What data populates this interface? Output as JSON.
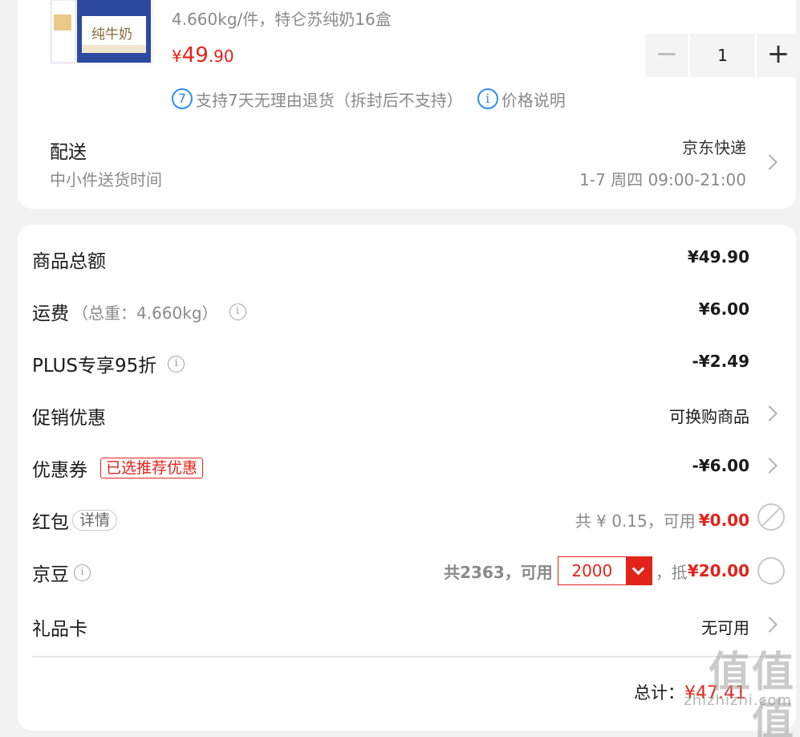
{
  "product": {
    "spec": "4.660kg/件，特仑苏纯奶16盒",
    "image_text": "纯牛奶",
    "price_yen": "¥",
    "price_int": "49",
    "price_dec": ".90",
    "quantity": "1",
    "minus_symbol": "−",
    "plus_symbol": "+",
    "badge_7_icon_text": "7",
    "badge_7_text": "支持7天无理由退货（拆封后不支持）",
    "price_info_icon_text": "i",
    "price_info_text": "价格说明"
  },
  "delivery": {
    "label": "配送",
    "sub_label": "中小件送货时间",
    "carrier": "京东快递",
    "time": "1-7 周四 09:00-21:00"
  },
  "summary": {
    "goods_total_label": "商品总额",
    "goods_total_value": "¥49.90",
    "shipping_label": "运费",
    "shipping_weight": "（总重：4.660kg）",
    "shipping_value": "¥6.00",
    "plus_label": "PLUS专享95折",
    "plus_value": "-¥2.49",
    "promo_label": "促销优惠",
    "promo_value": "可换购商品",
    "coupon_label": "优惠券",
    "coupon_tag": "已选推荐优惠",
    "coupon_value": "-¥6.00",
    "redpacket_label": "红包",
    "redpacket_detail": "详情",
    "redpacket_text": "共 ¥ 0.15，可用",
    "redpacket_value": "¥0.00",
    "jingdou_label": "京豆",
    "jingdou_text": "共2363，可用",
    "jingdou_input": "2000",
    "jingdou_offset_text": "，抵",
    "jingdou_value": "¥20.00",
    "giftcard_label": "礼品卡",
    "giftcard_value": "无可用",
    "total_label": "总计：",
    "total_value": "¥47.41"
  },
  "watermark": {
    "main": "值值值",
    "sub": "zhizhizhi.com"
  },
  "colors": {
    "accent": "#e2231a",
    "link_blue": "#2f8ee8"
  }
}
